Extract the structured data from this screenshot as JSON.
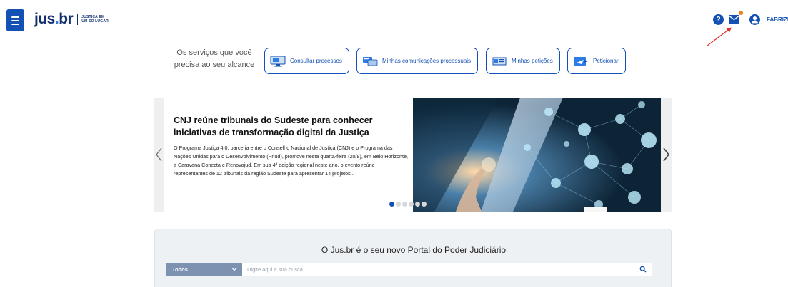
{
  "header": {
    "logo": {
      "main": "jus",
      "dot": ".",
      "suffix": "br",
      "tagline_1": "JUSTIÇA EM",
      "tagline_2": "UM SÓ LUGAR"
    },
    "help_label": "?",
    "user_name": "FABRIZIO TI",
    "brand_color": "#1351b4",
    "notification_dot_color": "#f07e26"
  },
  "services": {
    "intro_line1": "Os serviços que você",
    "intro_line2": "precisa ao seu alcance",
    "buttons": [
      {
        "label": "Consultar processos",
        "icon": "monitor-icon"
      },
      {
        "label": "Minhas comunicações processuais",
        "icon": "messages-icon"
      },
      {
        "label": "Minhas petições",
        "icon": "documents-icon"
      },
      {
        "label": "Peticionar",
        "icon": "send-document-icon"
      }
    ]
  },
  "news": {
    "title": "CNJ reúne tribunais do Sudeste para conhecer iniciativas de transformação digital da Justiça",
    "body": "O Programa Justiça 4.0, parceria entre o Conselho Nacional de Justiça (CNJ) e o Programa das Nações Unidas para o Desenvolvimento (Pnud), promove nesta quarta-feira (20/8), em Belo Horizonte, a Caravana Conecta e Renovajud. Em sua 4ª edição regional neste ano, o evento reúne representantes de 12 tribunais da região Sudeste para apresentar 14 projetos...",
    "slide_count": 6,
    "active_slide": 0
  },
  "portal": {
    "title": "O Jus.br é o seu novo Portal do Poder Judiciário",
    "filter_value": "Todos",
    "search_placeholder": "Digite aqui a sua busca"
  }
}
